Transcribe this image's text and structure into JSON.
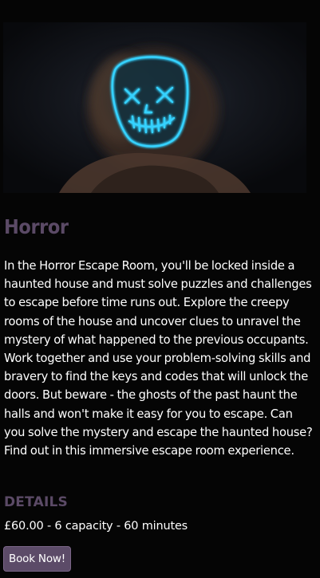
{
  "room": {
    "image_subject": "person wearing glowing neon purge mask",
    "image_accent_color": "#36d2ff",
    "title": "Horror",
    "description": "In the Horror Escape Room, you'll be locked inside a haunted house and must solve puzzles and challenges to escape before time runs out. Explore the creepy rooms of the house and uncover clues to unravel the mystery of what happened to the previous occupants. Work together and use your problem-solving skills and bravery to find the keys and codes that will unlock the doors. But beware - the ghosts of the past haunt the halls and won't make it easy for you to escape. Can you solve the mystery and escape the haunted house? Find out in this immersive escape room experience.",
    "details_heading": "DETAILS",
    "details_line": "£60.00 - 6 capacity - 60 minutes",
    "book_label": "Book Now!"
  },
  "colors": {
    "background": "#050505",
    "accent_purple": "#5b4a66",
    "button_bg": "#5c4b68",
    "text": "#ffffff"
  }
}
